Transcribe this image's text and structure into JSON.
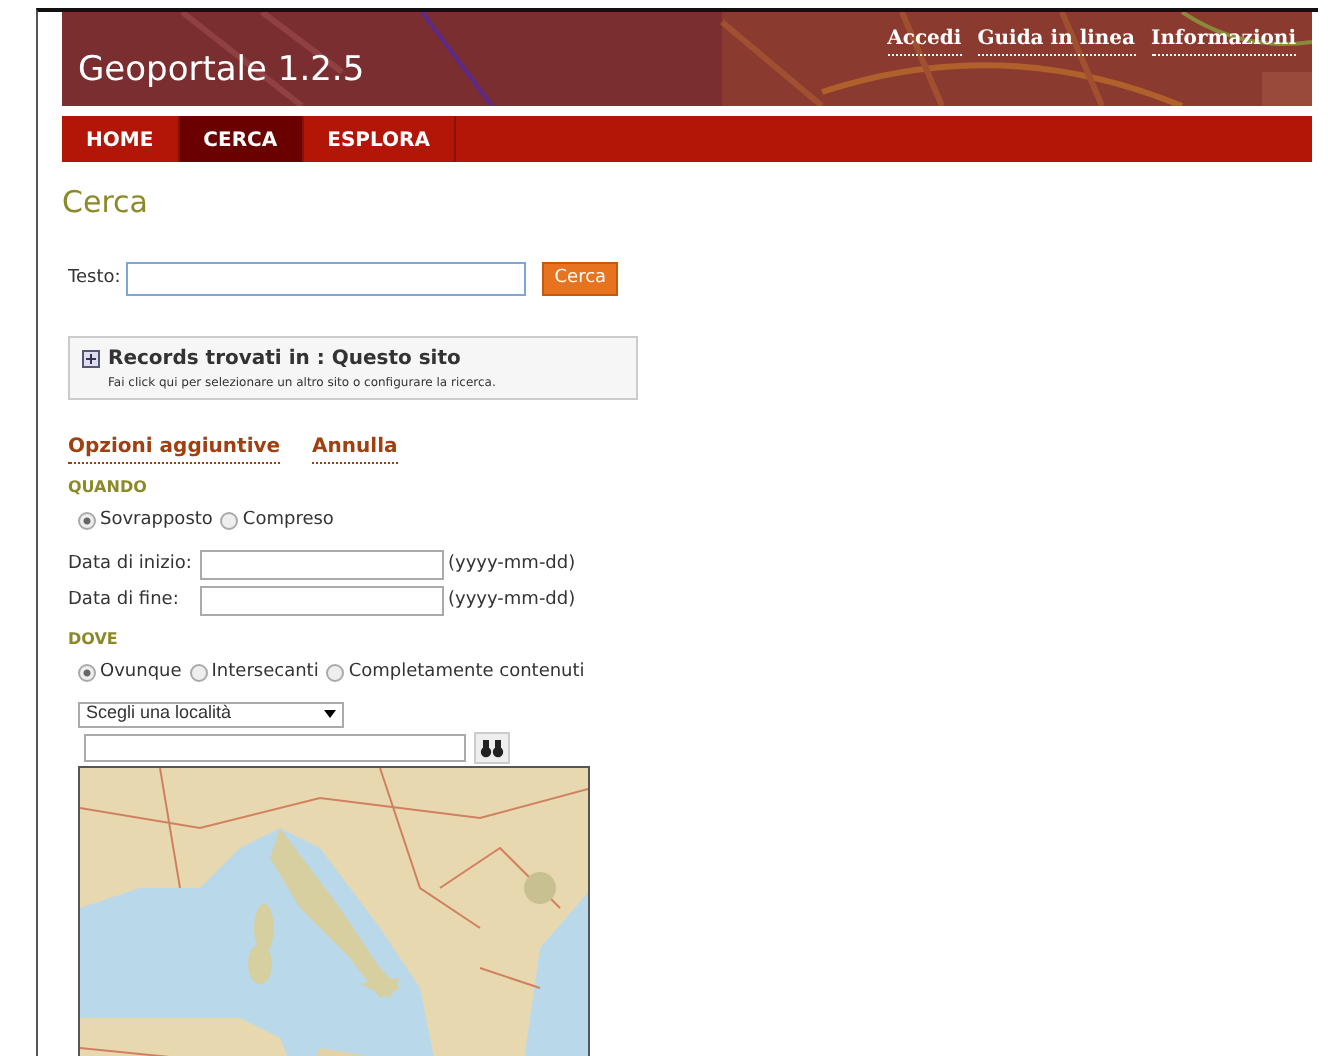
{
  "header": {
    "title": "Geoportale 1.2.5",
    "links": [
      "Accedi",
      "Guida in linea",
      "Informazioni"
    ]
  },
  "nav": [
    {
      "label": "HOME",
      "selected": false
    },
    {
      "label": "CERCA",
      "selected": true
    },
    {
      "label": "ESPLORA",
      "selected": false
    }
  ],
  "page_title": "Cerca",
  "search": {
    "label": "Testo:",
    "button": "Cerca"
  },
  "records": {
    "title": "Records trovati in : Questo sito",
    "hint": "Fai click qui per selezionare un altro sito o configurare la ricerca."
  },
  "options": {
    "links": [
      "Opzioni aggiuntive",
      "Annulla"
    ]
  },
  "when": {
    "heading": "QUANDO",
    "radios": [
      {
        "label": "Sovrapposto",
        "selected": true
      },
      {
        "label": "Compreso",
        "selected": false
      }
    ],
    "dates": [
      {
        "label": "Data di inizio:",
        "format": "(yyyy-mm-dd)"
      },
      {
        "label": "Data di fine:",
        "format": "(yyyy-mm-dd)"
      }
    ]
  },
  "where": {
    "heading": "DOVE",
    "radios": [
      {
        "label": "Ovunque",
        "selected": true
      },
      {
        "label": "Intersecanti",
        "selected": false
      },
      {
        "label": "Completamente contenuti",
        "selected": false
      }
    ],
    "location_select": "Scegli una località"
  }
}
